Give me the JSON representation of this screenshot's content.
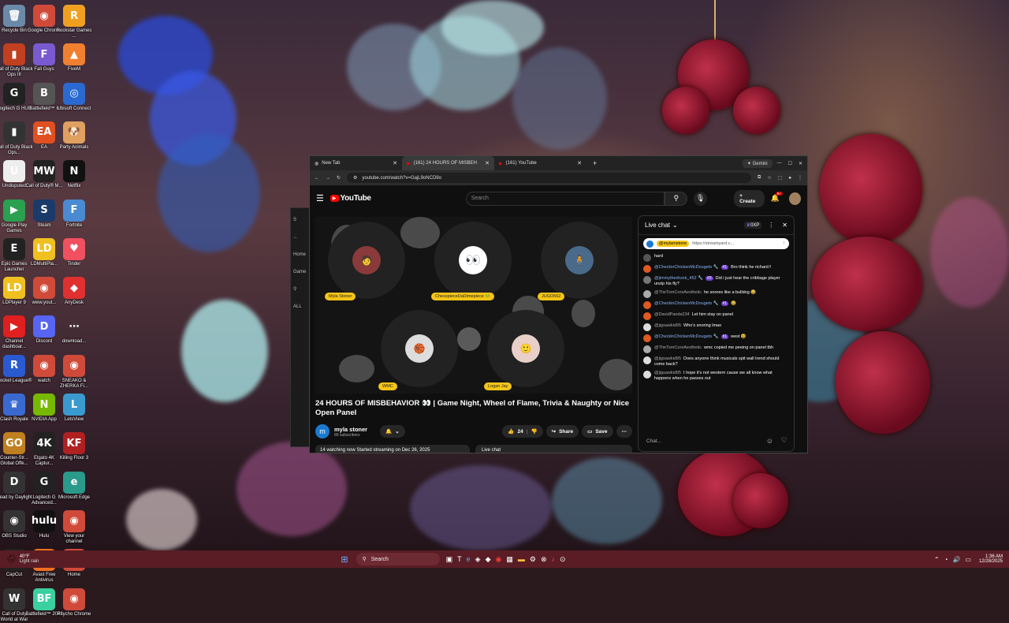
{
  "desktop": {
    "icons": [
      {
        "label": "Recycle Bin",
        "g": "🗑",
        "c": "#6a8aa8"
      },
      {
        "label": "Google Chrome",
        "g": "◉",
        "c": "#d04a3a"
      },
      {
        "label": "Rockstar Games ...",
        "g": "R",
        "c": "#f0a020"
      },
      {
        "label": "Call of Duty Black Ops III",
        "g": "▮",
        "c": "#c04020"
      },
      {
        "label": "Fall Guys",
        "g": "F",
        "c": "#7a5ad0"
      },
      {
        "label": "FiveM",
        "g": "▲",
        "c": "#f08030"
      },
      {
        "label": "Logitech G HUB",
        "g": "G",
        "c": "#222"
      },
      {
        "label": "Battlefield™ 6",
        "g": "B",
        "c": "#555"
      },
      {
        "label": "Ubisoft Connect",
        "g": "◎",
        "c": "#2a6ad0"
      },
      {
        "label": "Call of Duty Black Ops...",
        "g": "▮",
        "c": "#333"
      },
      {
        "label": "EA",
        "g": "EA",
        "c": "#e05020"
      },
      {
        "label": "Party Animals",
        "g": "🐶",
        "c": "#e0a060"
      },
      {
        "label": "Undisputed",
        "g": "U",
        "c": "#eee"
      },
      {
        "label": "Call of Duty® M...",
        "g": "MW",
        "c": "#222"
      },
      {
        "label": "Netflix",
        "g": "N",
        "c": "#111"
      },
      {
        "label": "Google Play Games",
        "g": "▶",
        "c": "#2aa050"
      },
      {
        "label": "Steam",
        "g": "S",
        "c": "#1a3a6a"
      },
      {
        "label": "Fortnite",
        "g": "F",
        "c": "#4a8ad0"
      },
      {
        "label": "Epic Games Launcher",
        "g": "E",
        "c": "#222"
      },
      {
        "label": "LDMultiPla...",
        "g": "LD",
        "c": "#f0c020"
      },
      {
        "label": "Tinder",
        "g": "♥",
        "c": "#f05060"
      },
      {
        "label": "LDPlayer 9",
        "g": "LD",
        "c": "#f0c020"
      },
      {
        "label": "www.yout...",
        "g": "◉",
        "c": "#d04a3a"
      },
      {
        "label": "AnyDesk",
        "g": "◆",
        "c": "#e03030"
      },
      {
        "label": "Channel dashboar...",
        "g": "▶",
        "c": "#e02020"
      },
      {
        "label": "Discord",
        "g": "D",
        "c": "#5865f2"
      },
      {
        "label": "download...",
        "g": "⋯",
        "c": "transparent"
      },
      {
        "label": "Rocket League®",
        "g": "R",
        "c": "#2a5ad0"
      },
      {
        "label": "watch",
        "g": "◉",
        "c": "#d04a3a"
      },
      {
        "label": "SNEAKO & ZHERKA Fi...",
        "g": "◉",
        "c": "#d04a3a"
      },
      {
        "label": "Clash Royale",
        "g": "♛",
        "c": "#3a6ad0"
      },
      {
        "label": "NVIDIA App",
        "g": "N",
        "c": "#76b900"
      },
      {
        "label": "LetsView",
        "g": "L",
        "c": "#3a9ad0"
      },
      {
        "label": "Counter-Str... Global Offe...",
        "g": "GO",
        "c": "#c08020"
      },
      {
        "label": "Elgato 4K Captur...",
        "g": "4K",
        "c": "#222"
      },
      {
        "label": "Killing Floor 3",
        "g": "KF",
        "c": "#b02020"
      },
      {
        "label": "Dead by Daylight",
        "g": "D",
        "c": "#333"
      },
      {
        "label": "Logitech G Advanced...",
        "g": "G",
        "c": "#222"
      },
      {
        "label": "Microsoft Edge",
        "g": "e",
        "c": "#2a9a8a"
      },
      {
        "label": "OBS Studio",
        "g": "◉",
        "c": "#333"
      },
      {
        "label": "Hulu",
        "g": "hulu",
        "c": "#111"
      },
      {
        "label": "View your channel",
        "g": "◉",
        "c": "#d04a3a"
      },
      {
        "label": "CapCut",
        "g": "✂",
        "c": "#222"
      },
      {
        "label": "Avast Free Antivirus",
        "g": "A",
        "c": "#f07020"
      },
      {
        "label": "Home",
        "g": "◉",
        "c": "#d04a3a"
      },
      {
        "label": "Call of Duty World at War",
        "g": "W",
        "c": "#333"
      },
      {
        "label": "Battlefield™ 2042",
        "g": "BF",
        "c": "#3ad0a0"
      },
      {
        "label": "Psycho Chrome",
        "g": "◉",
        "c": "#d04a3a"
      }
    ]
  },
  "browser": {
    "tabs": [
      {
        "title": "New Tab"
      },
      {
        "title": "(161) 24 HOURS OF MISBEH"
      },
      {
        "title": "(161) YouTube"
      }
    ],
    "gemini": "Gemini",
    "url": "youtube.com/watch?v=GajL9oNCD9o"
  },
  "youtube": {
    "logo": "YouTube",
    "search_placeholder": "Search",
    "create": "Create",
    "notif_count": "9+",
    "participants": [
      {
        "name": "Myla Stoner"
      },
      {
        "name": "ChesspieceDaDimepiece 🐸"
      },
      {
        "name": "JUGO562"
      },
      {
        "name": "WMC"
      },
      {
        "name": "Logan Jay"
      }
    ],
    "video_title": "24 HOURS OF MISBEHAVIOR 👀 | Game Night, Wheel of Flame, Trivia & Naughty or Nice Open Panel",
    "channel": {
      "name": "myla stoner",
      "subs": "89 subscribers",
      "initial": "m"
    },
    "likes": "24",
    "share": "Share",
    "save": "Save",
    "desc_snippet": "14 watching now  Started streaming on Dec 26, 2025",
    "live_chat_label": "Live chat"
  },
  "chat": {
    "title": "Live chat",
    "xp": "0XP",
    "pinned_user": "@mylamstone",
    "pinned_link": "https://streamyard.c...",
    "input_placeholder": "Chat...",
    "messages": [
      {
        "user": "",
        "text": "hard",
        "c": "#555"
      },
      {
        "user": "@CheckinChickenMcDougets 🔧",
        "badge": "#1",
        "text": "Bro think he richard f",
        "c": "#e05a20"
      },
      {
        "user": "@jimmythedrunk_452 🔧",
        "badge": "#3",
        "text": "Did i just hear the cribbage player unzip his fly?",
        "c": "#777"
      },
      {
        "user": "@TheTomCoreAesthetic",
        "text": "he snores like a bulldog 😂",
        "c": "#aaa",
        "g": true
      },
      {
        "user": "@CheckinChickenMcDougets 🔧",
        "badge": "#1",
        "text": "😂",
        "c": "#e05a20"
      },
      {
        "user": "@DavidPanda234",
        "text": "Let him stay on panel",
        "c": "#e05a20",
        "g": true
      },
      {
        "user": "@jigsawkid95",
        "text": "Who's snoring lmao",
        "c": "#ddd",
        "g": true
      },
      {
        "user": "@CheckinChickenMcDougets 🔧",
        "badge": "#1",
        "text": "west 😆",
        "c": "#e05a20"
      },
      {
        "user": "@TheTomCoreAesthetic",
        "text": "wmc copied me peeing on panel tbh",
        "c": "#aaa",
        "g": true
      },
      {
        "user": "@jigsawkid95",
        "text": "Does anyone think musicals spit wall trend should come back?",
        "c": "#ddd",
        "g": true
      },
      {
        "user": "@jigsawkid95",
        "text": "I hope it's not western cause we all know what happens when he passes out",
        "c": "#ddd",
        "g": true
      }
    ]
  },
  "taskbar": {
    "weather_temp": "40°F",
    "weather_desc": "Light rain",
    "search": "Search",
    "time": "1:36 AM",
    "date": "12/28/2025"
  }
}
